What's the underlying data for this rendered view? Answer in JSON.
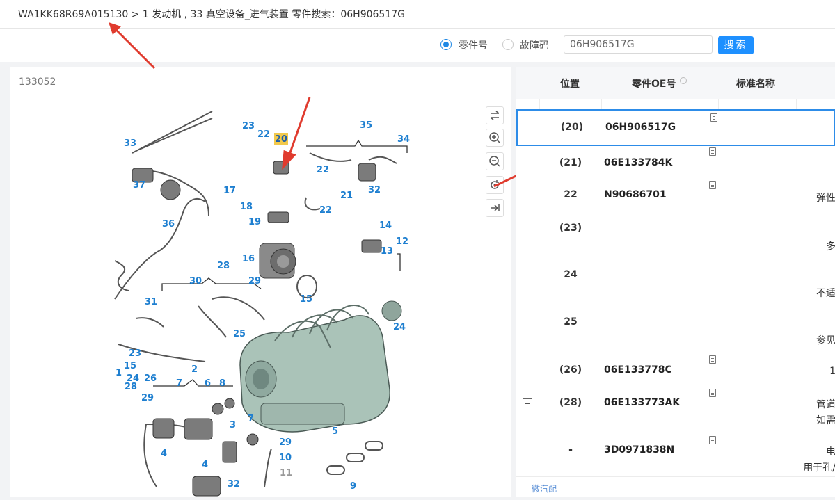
{
  "breadcrumb": "WA1KK68R69A015130 > 1 发动机 , 33 真空设备_进气装置 零件搜索：06H906517G",
  "search": {
    "options": [
      {
        "label": "零件号",
        "checked": true
      },
      {
        "label": "故障码",
        "checked": false
      }
    ],
    "value": "06H906517G",
    "button_label": "搜索"
  },
  "diagram": {
    "id": "133052",
    "highlighted_callout": "20",
    "callouts": [
      "33",
      "23",
      "22",
      "20",
      "35",
      "34",
      "37",
      "22",
      "32",
      "17",
      "18",
      "21",
      "22",
      "19",
      "36",
      "14",
      "12",
      "13",
      "16",
      "28",
      "30",
      "29",
      "15",
      "31",
      "25",
      "24",
      "23",
      "15",
      "24",
      "26",
      "1",
      "28",
      "2",
      "7",
      "6",
      "8",
      "29",
      "3",
      "7",
      "5",
      "4",
      "4",
      "29",
      "10",
      "11",
      "9",
      "32"
    ],
    "tools": [
      "swap-icon",
      "zoom-in-icon",
      "zoom-out-icon",
      "reset-icon",
      "collapse-icon"
    ]
  },
  "parts_table": {
    "columns": [
      "位置",
      "零件OE号",
      "标准名称"
    ],
    "rows": [
      {
        "pos": "(20)",
        "oe": "06H906517G",
        "name": "",
        "doc": true,
        "selected": true,
        "expand": false
      },
      {
        "pos": "(21)",
        "oe": "06E133784K",
        "name": "",
        "doc": true,
        "selected": false,
        "expand": false
      },
      {
        "pos": "22",
        "oe": "N90686701",
        "name": "弹性",
        "doc": true,
        "selected": false,
        "expand": false
      },
      {
        "pos": "(23)",
        "oe": "",
        "name": "多",
        "doc": false,
        "selected": false,
        "expand": false
      },
      {
        "pos": "24",
        "oe": "",
        "name": "不适",
        "doc": false,
        "selected": false,
        "expand": false
      },
      {
        "pos": "25",
        "oe": "",
        "name": "参见",
        "doc": false,
        "selected": false,
        "expand": false
      },
      {
        "pos": "(26)",
        "oe": "06E133778C",
        "name": "1",
        "doc": true,
        "selected": false,
        "expand": false
      },
      {
        "pos": "(28)",
        "oe": "06E133773AK",
        "name": "管道",
        "name2": "如需",
        "doc": true,
        "selected": false,
        "expand": true
      },
      {
        "pos": "-",
        "oe": "3D0971838N",
        "name": "电",
        "name2": "用于孔/",
        "doc": true,
        "selected": false,
        "expand": false
      }
    ],
    "footer": "微汽配"
  },
  "colors": {
    "accent": "#1e90ff",
    "callout": "#1e7fd0",
    "arrow": "#e03b2e",
    "highlight": "#f2c94c"
  }
}
